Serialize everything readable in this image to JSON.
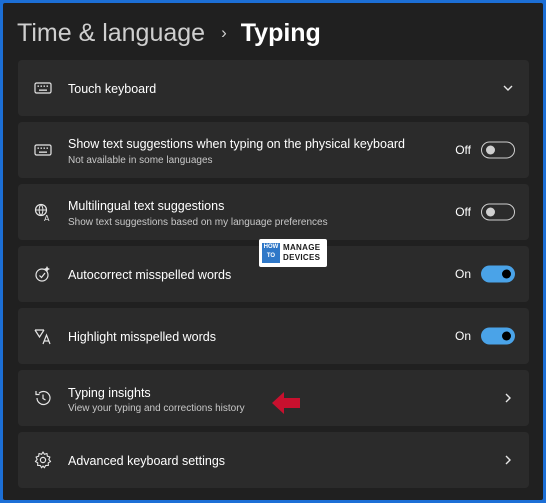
{
  "breadcrumb": {
    "parent": "Time & language",
    "separator": "›",
    "current": "Typing"
  },
  "settings": [
    {
      "title": "Touch keyboard",
      "subtitle": "",
      "icon": "keyboard-icon",
      "control": "expand"
    },
    {
      "title": "Show text suggestions when typing on the physical keyboard",
      "subtitle": "Not available in some languages",
      "icon": "keyboard-icon",
      "control": "toggle",
      "state": "Off",
      "on": false
    },
    {
      "title": "Multilingual text suggestions",
      "subtitle": "Show text suggestions based on my language preferences",
      "icon": "language-icon",
      "control": "toggle",
      "state": "Off",
      "on": false
    },
    {
      "title": "Autocorrect misspelled words",
      "subtitle": "",
      "icon": "autocorrect-icon",
      "control": "toggle",
      "state": "On",
      "on": true
    },
    {
      "title": "Highlight misspelled words",
      "subtitle": "",
      "icon": "spellcheck-icon",
      "control": "toggle",
      "state": "On",
      "on": true
    },
    {
      "title": "Typing insights",
      "subtitle": "View your typing and corrections history",
      "icon": "history-icon",
      "control": "navigate"
    },
    {
      "title": "Advanced keyboard settings",
      "subtitle": "",
      "icon": "gear-icon",
      "control": "navigate"
    }
  ],
  "watermark": {
    "how": "HOW",
    "to": "TO",
    "line1": "MANAGE",
    "line2": "DEVICES"
  },
  "colors": {
    "background": "#202020",
    "card": "#2b2b2b",
    "accent": "#4aa3e8",
    "arrow": "#c8102e",
    "frame": "#1c6fd6"
  }
}
